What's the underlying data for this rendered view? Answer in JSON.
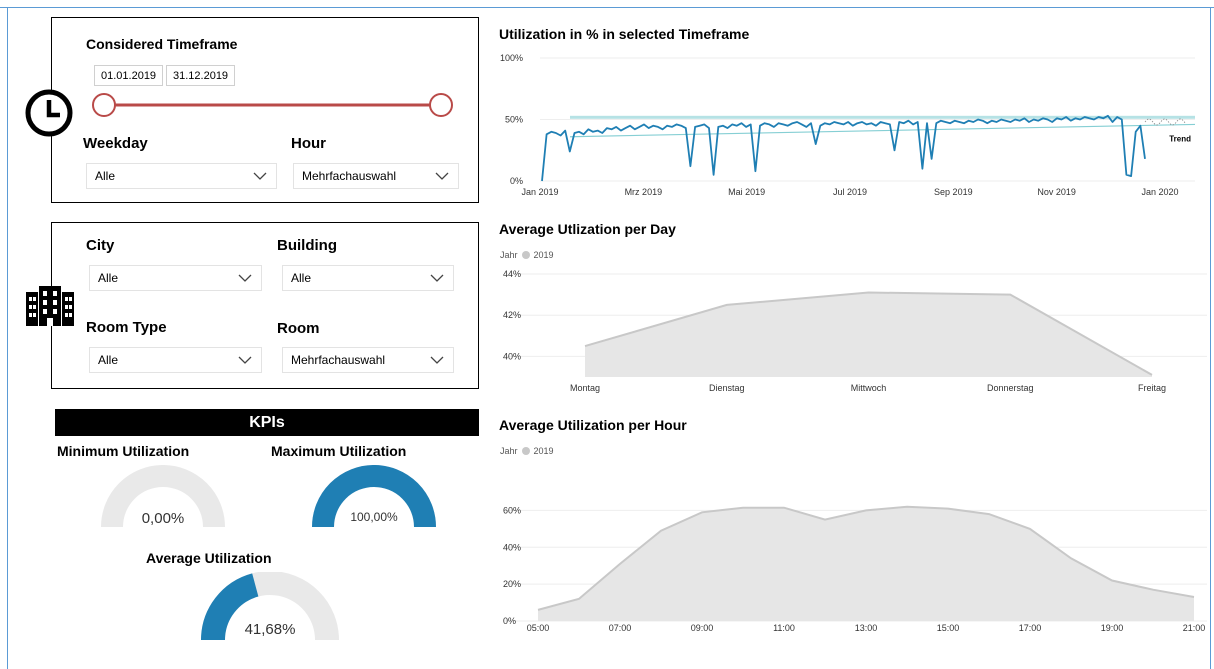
{
  "timeframe": {
    "title": "Considered Timeframe",
    "start_date": "01.01.2019",
    "end_date": "31.12.2019",
    "weekday_label": "Weekday",
    "weekday_value": "Alle",
    "hour_label": "Hour",
    "hour_value": "Mehrfachauswahl"
  },
  "location": {
    "city_label": "City",
    "city_value": "Alle",
    "building_label": "Building",
    "building_value": "Alle",
    "roomtype_label": "Room Type",
    "roomtype_value": "Alle",
    "room_label": "Room",
    "room_value": "Mehrfachauswahl"
  },
  "kpis": {
    "title": "KPIs",
    "min_label": "Minimum Utilization",
    "min_value": "0,00%",
    "min_fraction": 0.0,
    "max_label": "Maximum Utilization",
    "max_value": "100,00%",
    "max_fraction": 1.0,
    "avg_label": "Average Utilization",
    "avg_value": "41,68%",
    "avg_fraction": 0.4168
  },
  "colors": {
    "accent": "#1f7fb4",
    "gauge_bg": "#e9e9e9",
    "slider": "#b94a48",
    "area_fill": "#e6e6e6",
    "area_line": "#c8c8c8",
    "trend": "#86cfd4"
  },
  "chart_data": [
    {
      "type": "line",
      "title": "Utilization in % in selected Timeframe",
      "y_ticks": [
        "100%",
        "50%",
        "0%"
      ],
      "ylim": [
        0,
        100
      ],
      "x_ticks": [
        "Jan 2019",
        "Mrz 2019",
        "Mai 2019",
        "Jul 2019",
        "Sep 2019",
        "Nov 2019",
        "Jan 2020"
      ],
      "annotation": "Trend",
      "series": [
        {
          "values": [
            0,
            38,
            40,
            39,
            37,
            41,
            24,
            39,
            40,
            38,
            42,
            40,
            41,
            39,
            43,
            42,
            44,
            41,
            43,
            45,
            42,
            44,
            46,
            43,
            45,
            44,
            42,
            45,
            44,
            46,
            45,
            43,
            12,
            44,
            45,
            46,
            43,
            5,
            44,
            45,
            43,
            46,
            45,
            47,
            44,
            46,
            8,
            45,
            47,
            46,
            44,
            47,
            46,
            45,
            47,
            48,
            46,
            44,
            47,
            30,
            45,
            47,
            46,
            48,
            47,
            46,
            48,
            45,
            47,
            48,
            46,
            47,
            45,
            48,
            47,
            46,
            25,
            48,
            47,
            49,
            46,
            48,
            10,
            47,
            18,
            47,
            49,
            48,
            47,
            49,
            48,
            47,
            49,
            48,
            50,
            49,
            47,
            49,
            48,
            50,
            49,
            48,
            50,
            49,
            51,
            48,
            50,
            49,
            51,
            50,
            48,
            51,
            50,
            52,
            49,
            51,
            50,
            52,
            51,
            50,
            52,
            51,
            53,
            48,
            52,
            50,
            5,
            4,
            40,
            45,
            18
          ]
        }
      ],
      "trend_range": [
        38,
        46
      ]
    },
    {
      "type": "area",
      "title": "Average Utlization per Day",
      "legend_title": "Jahr",
      "legend": [
        "2019"
      ],
      "y_ticks": [
        "44%",
        "42%",
        "40%"
      ],
      "ylim": [
        39,
        44
      ],
      "categories": [
        "Montag",
        "Dienstag",
        "Mittwoch",
        "Donnerstag",
        "Freitag"
      ],
      "values": [
        40.5,
        42.5,
        43.1,
        43.0,
        39.1
      ]
    },
    {
      "type": "area",
      "title": "Average Utilization per Hour",
      "legend_title": "Jahr",
      "legend": [
        "2019"
      ],
      "y_ticks": [
        "60%",
        "40%",
        "20%",
        "0%"
      ],
      "ylim": [
        0,
        70
      ],
      "x_ticks": [
        "05:00",
        "07:00",
        "09:00",
        "11:00",
        "13:00",
        "15:00",
        "17:00",
        "19:00",
        "21:00"
      ],
      "hours": [
        "05:00",
        "06:00",
        "07:00",
        "08:00",
        "09:00",
        "10:00",
        "11:00",
        "12:00",
        "13:00",
        "14:00",
        "15:00",
        "16:00",
        "17:00",
        "18:00",
        "19:00",
        "20:00",
        "21:00"
      ],
      "values": [
        6,
        12,
        31,
        49,
        59,
        61.5,
        61.5,
        55,
        60,
        62,
        61,
        58,
        50,
        34,
        22,
        17,
        13
      ]
    }
  ]
}
